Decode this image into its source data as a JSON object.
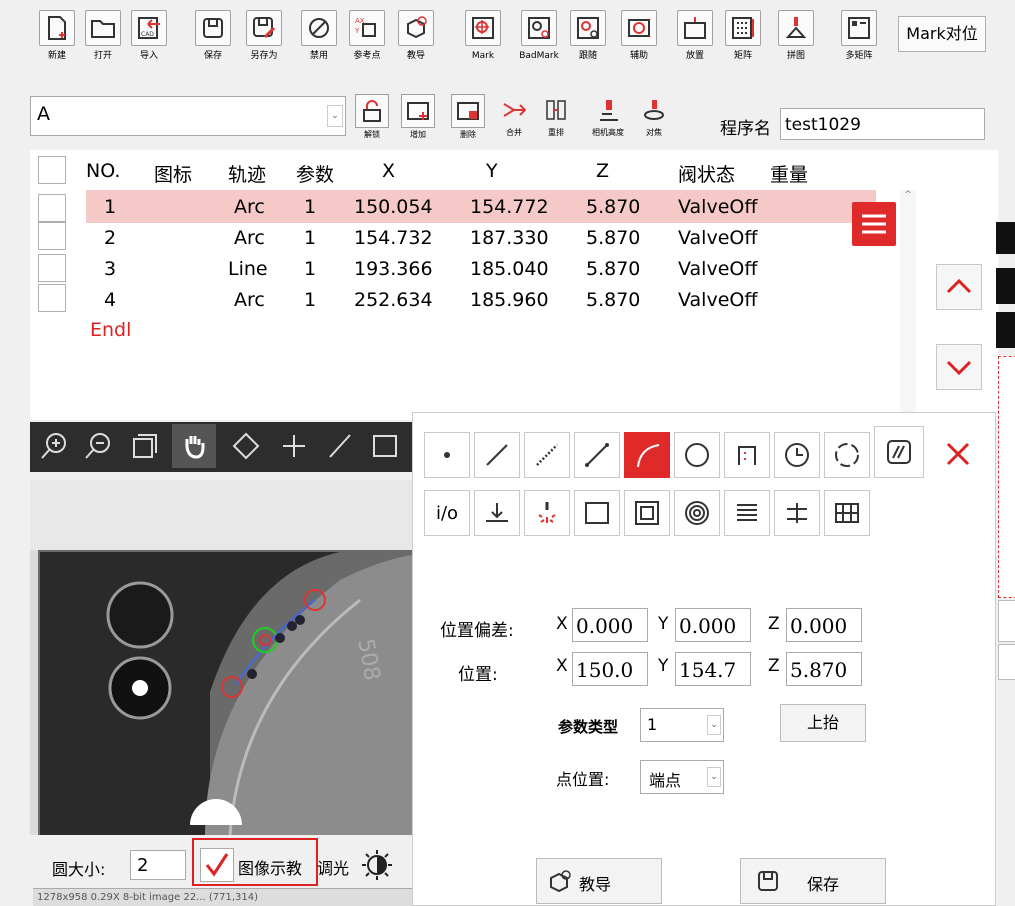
{
  "toolbar": {
    "new": "新建",
    "open": "打开",
    "import": "导入",
    "save": "保存",
    "save_as": "另存为",
    "disable": "禁用",
    "reference_point": "参考点",
    "teach": "教导",
    "mark": "Mark",
    "bad_mark": "BadMark",
    "follow": "跟随",
    "assist": "辅助",
    "place": "放置",
    "matrix": "矩阵",
    "stitch": "拼图",
    "multi_matrix": "多矩阵",
    "mark_align": "Mark对位"
  },
  "toolbar2": {
    "unlock": "解锁",
    "add": "增加",
    "delete": "删除",
    "merge": "合并",
    "reorder": "重排",
    "camera_height": "相机高度",
    "focus": "对焦"
  },
  "combo": {
    "value": "A"
  },
  "program": {
    "label": "程序名",
    "value": "test1029"
  },
  "table": {
    "headers": {
      "no": "NO.",
      "icon": "图标",
      "track": "轨迹",
      "param": "参数",
      "x": "X",
      "y": "Y",
      "z": "Z",
      "valve": "阀状态",
      "weight": "重量"
    },
    "rows": [
      {
        "no": "1",
        "track": "Arc",
        "param": "1",
        "x": "150.054",
        "y": "154.772",
        "z": "5.870",
        "valve": "ValveOff"
      },
      {
        "no": "2",
        "track": "Arc",
        "param": "1",
        "x": "154.732",
        "y": "187.330",
        "z": "5.870",
        "valve": "ValveOff"
      },
      {
        "no": "3",
        "track": "Line",
        "param": "1",
        "x": "193.366",
        "y": "185.040",
        "z": "5.870",
        "valve": "ValveOff"
      },
      {
        "no": "4",
        "track": "Arc",
        "param": "1",
        "x": "252.634",
        "y": "185.960",
        "z": "5.870",
        "valve": "ValveOff"
      }
    ],
    "end_label": "Endl"
  },
  "panel": {
    "offset_label": "位置偏差:",
    "position_label": "位置:",
    "offset": {
      "x": "0.000",
      "y": "0.000",
      "z": "0.000"
    },
    "position": {
      "x": "150.0",
      "y": "154.7",
      "z": "5.870"
    },
    "axis": {
      "x": "X",
      "y": "Y",
      "z": "Z"
    },
    "param_type_label": "参数类型",
    "param_type_value": "1",
    "lift_button": "上抬",
    "point_pos_label": "点位置:",
    "point_pos_value": "端点",
    "teach_button": "教导",
    "save_button": "保存",
    "io_label": "i/o"
  },
  "viewer": {
    "circle_size_label": "圆大小:",
    "circle_size_value": "2",
    "image_teach_label": "图像示教",
    "light_label": "调光",
    "status": "1278x958 0.29X 8-bit image 22... (771,314)"
  },
  "colors": {
    "selected_row": "#f6c9c9",
    "accent_red": "#e02929",
    "highlight_box": "#e02020"
  }
}
